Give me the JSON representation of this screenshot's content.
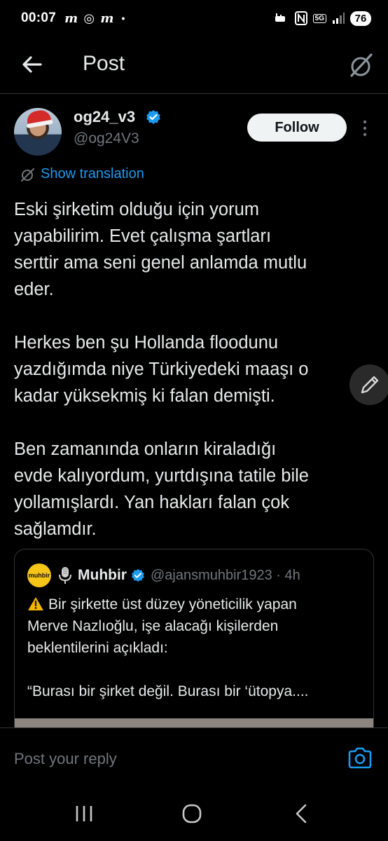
{
  "status_bar": {
    "time": "00:07",
    "notifications": "m ◎ m",
    "dot": "•",
    "network": "5G",
    "battery": "76"
  },
  "header": {
    "title": "Post",
    "back_icon": "arrow-left-icon",
    "grok_icon": "grok-icon"
  },
  "author": {
    "display_name": "og24_v3",
    "handle": "@og24V3",
    "follow_label": "Follow",
    "verified_color": "#1d9bf0"
  },
  "translation": {
    "label": "Show translation"
  },
  "tweet": {
    "text": "Eski şirketim olduğu için yorum\nyapabilirim. Evet çalışma şartları\nserttir ama seni genel anlamda mutlu\neder.\n\nHerkes ben şu Hollanda floodunu\nyazdığımda niye Türkiyedeki maaşı o\nkadar yüksekmiş ki falan demişti.\n\nBen zamanında onların kiraladığı\nevde kalıyordum, yurtdışına tatile bile\nyollamışlardı. Yan hakları falan çok\nsağlamdır."
  },
  "quote": {
    "avatar_text": "muhbir",
    "name": "Muhbir",
    "handle_time": "@ajansmuhbir1923 · 4h",
    "text": "Bir şirkette üst düzey yöneticilik yapan\nMerve Nazlıoğlu, işe alacağı kişilerden\nbeklentilerini açıkladı:\n\n“Burası bir şirket değil. Burası bir ‘ütopya...."
  },
  "reply": {
    "placeholder": "Post your reply"
  },
  "colors": {
    "background": "#000000",
    "text": "#e7e9ea",
    "muted": "#71767b",
    "accent": "#1d9bf0",
    "border": "#2f3336"
  }
}
